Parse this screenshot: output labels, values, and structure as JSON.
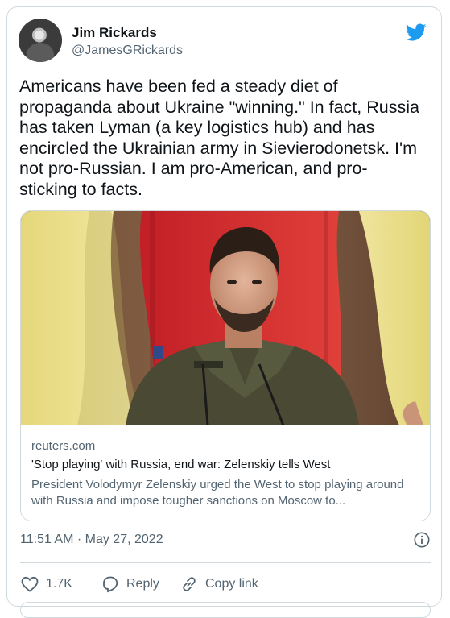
{
  "author": {
    "name": "Jim Rickards",
    "handle": "@JamesGRickards"
  },
  "tweet": {
    "text": "Americans have been fed a steady diet of\npropaganda about Ukraine \"winning.\" In fact, Russia\nhas taken Lyman (a key logistics hub) and has\nencircled the Ukrainian army in Sievierodonetsk. I'm\nnot pro-Russian. I am pro-American, and pro-\nsticking to facts.",
    "timestamp": "11:51 AM · May 27, 2022"
  },
  "link_card": {
    "domain": "reuters.com",
    "headline": "'Stop playing' with Russia, end war: Zelenskiy tells West",
    "description": "President Volodymyr Zelenskiy urged the West to stop playing around with Russia and impose tougher sanctions on Moscow to..."
  },
  "actions": {
    "like_count": "1.7K",
    "reply_label": "Reply",
    "copy_link_label": "Copy link"
  },
  "icons": {
    "brand": "twitter-bird-icon",
    "info": "info-icon",
    "like": "heart-icon",
    "reply": "reply-icon",
    "copy": "link-icon"
  },
  "colors": {
    "brand_blue": "#1d9bf0",
    "secondary_text": "#536471",
    "border": "#cfd9de"
  }
}
